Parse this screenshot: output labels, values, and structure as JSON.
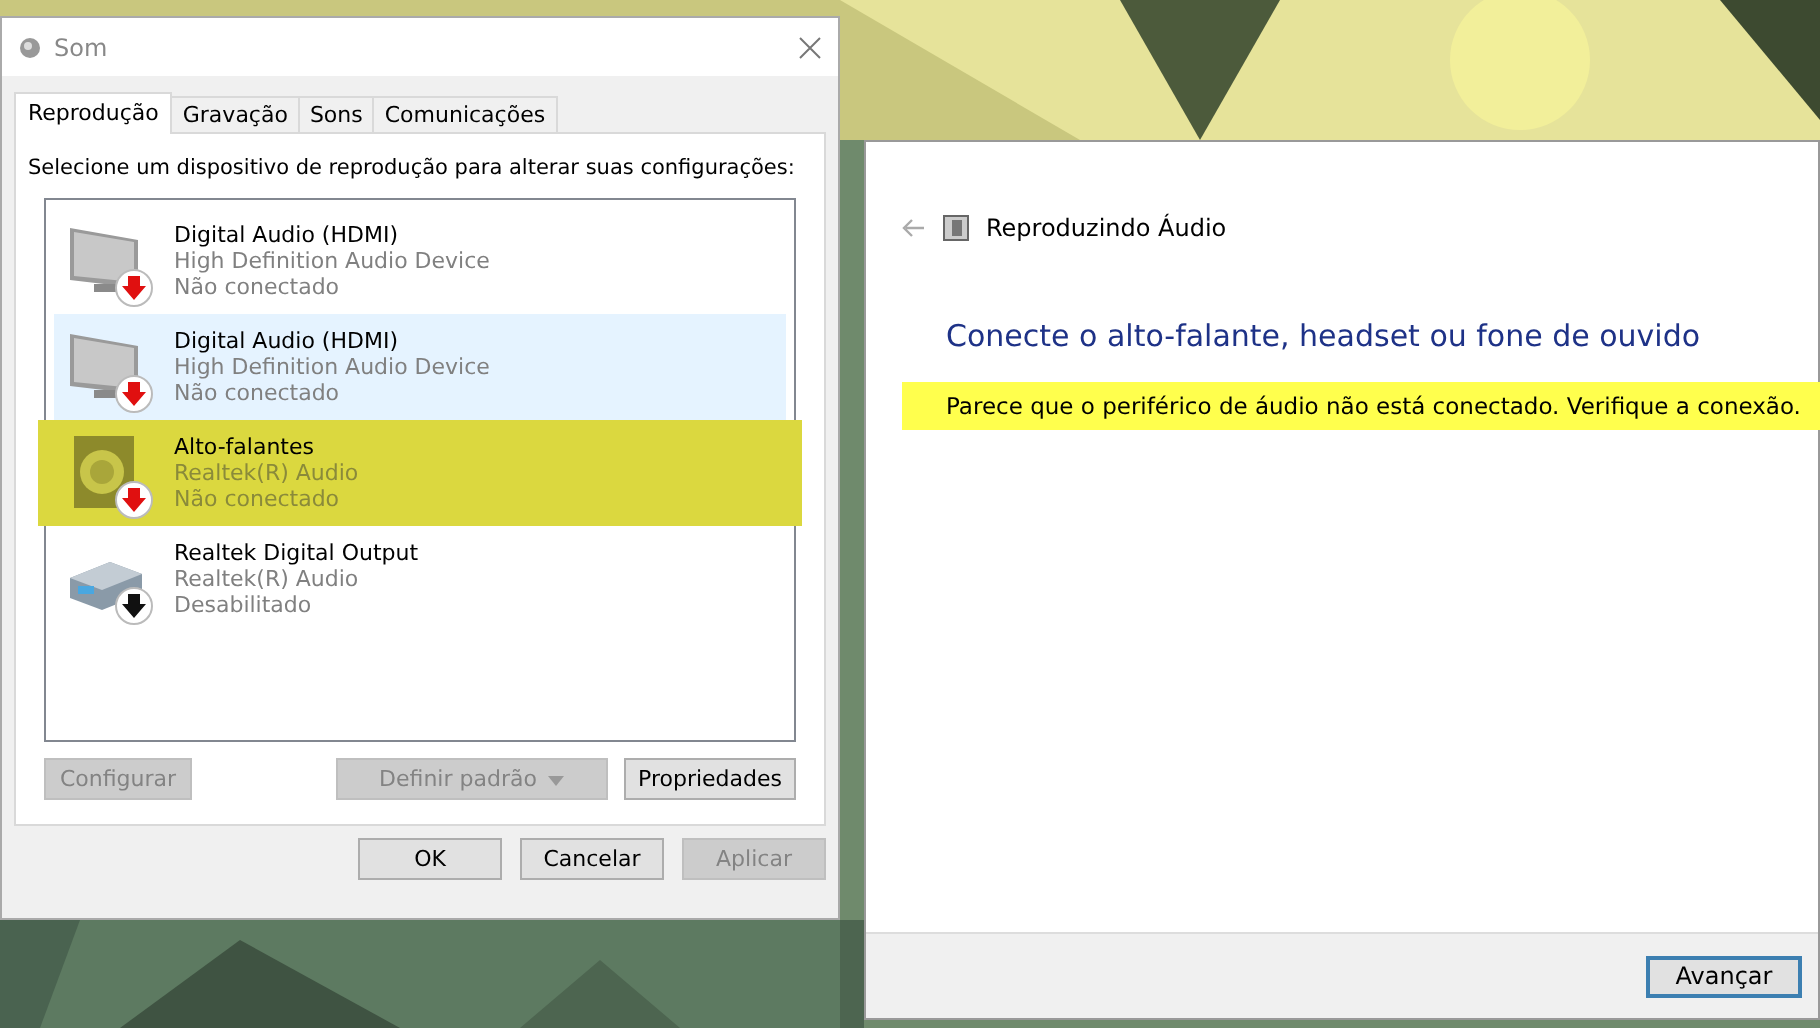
{
  "sound_window": {
    "title": "Som",
    "tabs": [
      {
        "label": "Reprodução",
        "selected": true
      },
      {
        "label": "Gravação",
        "selected": false
      },
      {
        "label": "Sons",
        "selected": false
      },
      {
        "label": "Comunicações",
        "selected": false
      }
    ],
    "instruction": "Selecione um dispositivo de reprodução para alterar suas configurações:",
    "devices": [
      {
        "kind": "monitor",
        "name": "Digital Audio (HDMI)",
        "driver": "High Definition Audio Device",
        "status": "Não conectado",
        "color": "#e01010",
        "selected": false,
        "highlighted": false
      },
      {
        "kind": "monitor",
        "name": "Digital Audio (HDMI)",
        "driver": "High Definition Audio Device",
        "status": "Não conectado",
        "color": "#e01010",
        "selected": true,
        "highlighted": false
      },
      {
        "kind": "speaker",
        "name": "Alto-falantes",
        "driver": "Realtek(R) Audio",
        "status": "Não conectado",
        "color": "#e01010",
        "selected": false,
        "highlighted": true
      },
      {
        "kind": "digital",
        "name": "Realtek Digital Output",
        "driver": "Realtek(R) Audio",
        "status": "Desabilitado",
        "color": "#111111",
        "selected": false,
        "highlighted": false
      }
    ],
    "device_buttons": [
      {
        "label": "Configurar",
        "disabled": true
      },
      {
        "label": "Definir padrão",
        "disabled": true
      },
      {
        "label": "Propriedades",
        "disabled": false
      }
    ],
    "dialog_buttons": [
      {
        "label": "OK",
        "disabled": false
      },
      {
        "label": "Cancelar",
        "disabled": false
      },
      {
        "label": "Aplicar",
        "disabled": true
      }
    ]
  },
  "troubleshooter": {
    "title": "Reproduzindo Áudio",
    "heading": "Conecte o alto-falante, headset ou fone de ouvido",
    "message": "Parece que o periférico de áudio não está conectado. Verifique a conexão.",
    "message_highlighted": true,
    "next_button": "Avançar"
  }
}
